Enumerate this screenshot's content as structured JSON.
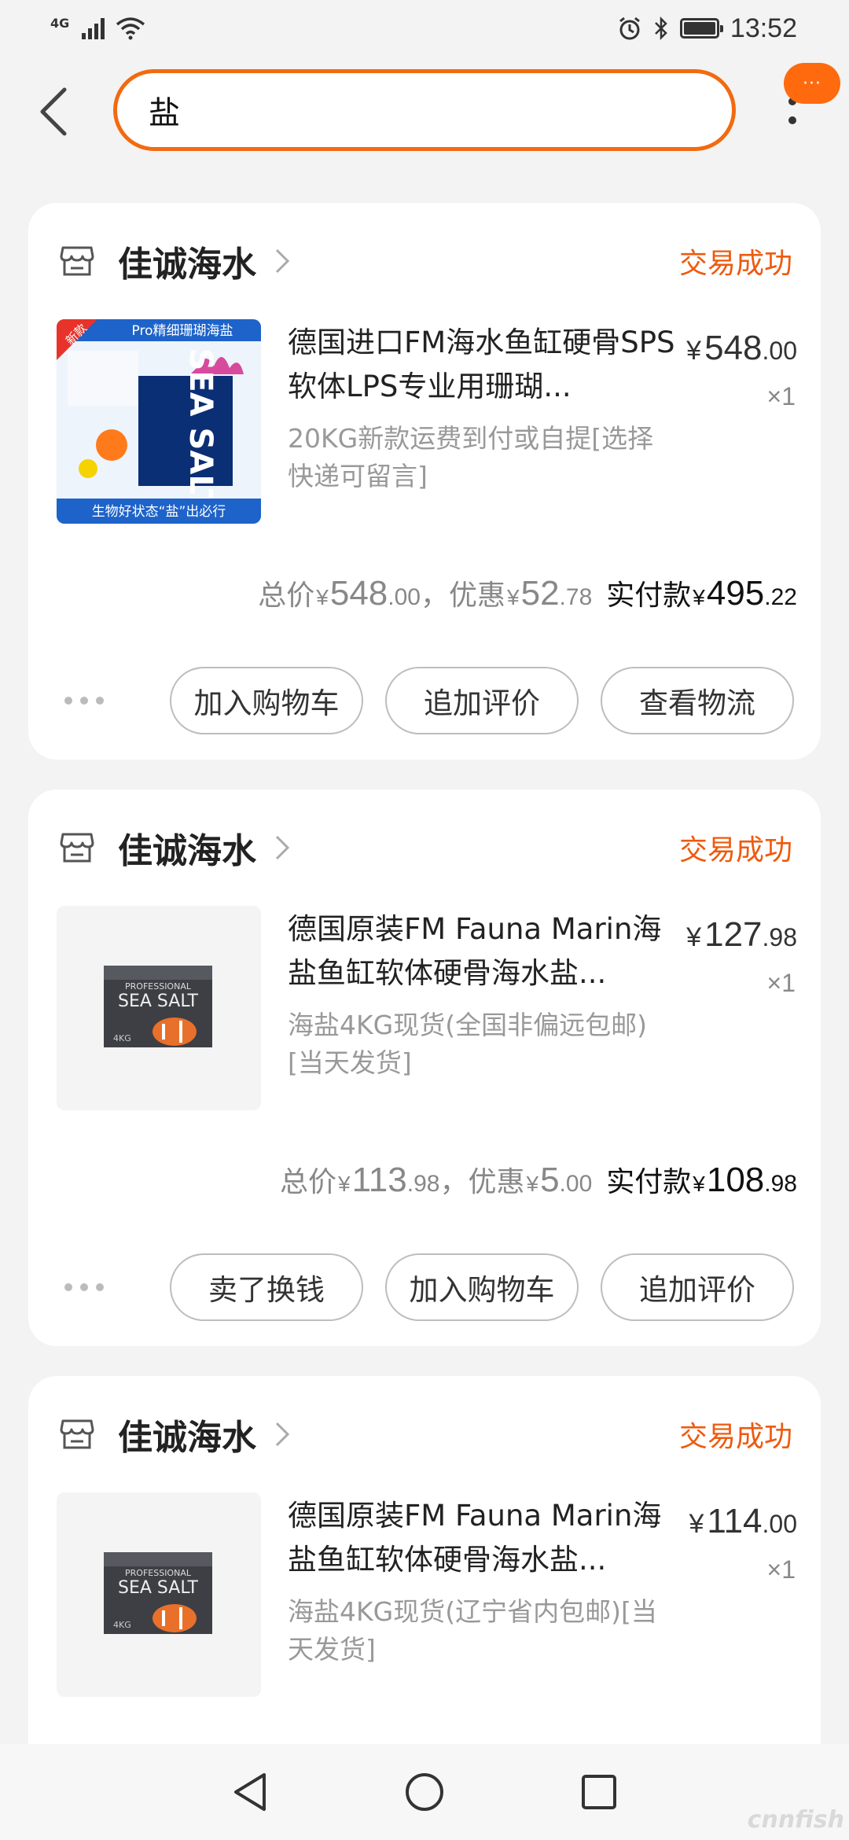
{
  "status_bar": {
    "network": "4G",
    "time": "13:52"
  },
  "search": {
    "value": "盐",
    "message_badge": "···"
  },
  "orders": [
    {
      "shop": "佳诚海水",
      "status": "交易成功",
      "title": "德国进口FM海水鱼缸硬骨SPS软体LPS专业用珊瑚...",
      "spec": "20KG新款运费到付或自提[选择快递可留言]",
      "price_int": "548",
      "price_dec": ".00",
      "qty": "×1",
      "thumb_texts": {
        "banner": "Pro精细珊瑚海盐",
        "tag": "新款",
        "footer": "生物好状态“盐”出必行",
        "box": "SEA SALT"
      },
      "summary": {
        "total_label": "总价",
        "total_int": "548",
        "total_dec": ".00",
        "discount_label": "，优惠",
        "discount_int": "52",
        "discount_dec": ".78",
        "paid_label": "实付款",
        "paid_int": "495",
        "paid_dec": ".22"
      },
      "buttons": [
        "加入购物车",
        "追加评价",
        "查看物流"
      ]
    },
    {
      "shop": "佳诚海水",
      "status": "交易成功",
      "title": "德国原装FM Fauna Marin海盐鱼缸软体硬骨海水盐...",
      "spec": "海盐4KG现货(全国非偏远包邮)[当天发货]",
      "price_int": "127",
      "price_dec": ".98",
      "qty": "×1",
      "thumb_texts": {
        "box": "SEA SALT",
        "sub": "PROFESSIONAL",
        "weight": "4KG"
      },
      "summary": {
        "total_label": "总价",
        "total_int": "113",
        "total_dec": ".98",
        "discount_label": "，优惠",
        "discount_int": "5",
        "discount_dec": ".00",
        "paid_label": "实付款",
        "paid_int": "108",
        "paid_dec": ".98"
      },
      "buttons": [
        "卖了换钱",
        "加入购物车",
        "追加评价"
      ]
    },
    {
      "shop": "佳诚海水",
      "status": "交易成功",
      "title": "德国原装FM Fauna Marin海盐鱼缸软体硬骨海水盐...",
      "spec": "海盐4KG现货(辽宁省内包邮)[当天发货]",
      "price_int": "114",
      "price_dec": ".00",
      "qty": "×1",
      "thumb_texts": {
        "box": "SEA SALT",
        "sub": "PROFESSIONAL",
        "weight": "4KG"
      }
    }
  ],
  "currency": "¥",
  "watermark": "cnnfish",
  "colors": {
    "accent": "#f26a10",
    "status_text": "#ee5a0e",
    "badge": "#ff6a0f"
  }
}
